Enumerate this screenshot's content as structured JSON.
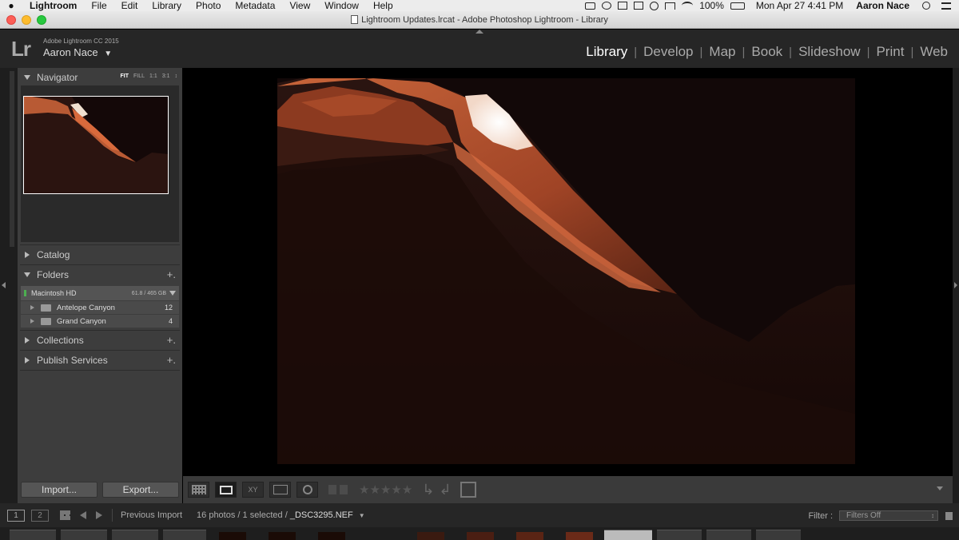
{
  "menubar": {
    "app_name": "Lightroom",
    "items": [
      "File",
      "Edit",
      "Library",
      "Photo",
      "Metadata",
      "View",
      "Window",
      "Help"
    ],
    "battery": "100%",
    "clock": "Mon Apr 27  4:41 PM",
    "user": "Aaron Nace"
  },
  "window": {
    "title": "Lightroom Updates.lrcat - Adobe Photoshop Lightroom - Library"
  },
  "identity": {
    "logo": "Lr",
    "product": "Adobe Lightroom CC 2015",
    "user": "Aaron Nace"
  },
  "modules": {
    "library": "Library",
    "develop": "Develop",
    "map": "Map",
    "book": "Book",
    "slideshow": "Slideshow",
    "print": "Print",
    "web": "Web",
    "separator": "|",
    "active": "Library"
  },
  "navigator": {
    "title": "Navigator",
    "fit": "FIT",
    "fill": "FILL",
    "one_to_one": "1:1",
    "three_to_one": "3:1",
    "stepper": "↕"
  },
  "panels": {
    "catalog": "Catalog",
    "folders": "Folders",
    "collections": "Collections",
    "publish": "Publish Services",
    "plus": "+."
  },
  "folders": {
    "drive": {
      "name": "Macintosh HD",
      "capacity": "61.8 / 465 GB"
    },
    "items": [
      {
        "name": "Antelope Canyon",
        "count": "12"
      },
      {
        "name": "Grand Canyon",
        "count": "4"
      }
    ]
  },
  "buttons": {
    "import": "Import...",
    "export": "Export..."
  },
  "toolbar": {
    "xy_label": "XY",
    "stars": "★★★★★",
    "rotate_left": "↳",
    "rotate_right": "↲"
  },
  "filmstrip": {
    "view1": "1",
    "view2": "2",
    "source": "Previous Import",
    "status_prefix": "16 photos / 1 selected /",
    "filename": "_DSC3295.NEF",
    "dropdown": "▼",
    "filter_label": "Filter :",
    "filter_value": "Filters Off",
    "filter_stepper": "↕"
  },
  "colors": {
    "panel": "#3d3d3d",
    "background": "#262626",
    "active_module": "#ffffff",
    "inactive_module": "#aaaaaa"
  }
}
